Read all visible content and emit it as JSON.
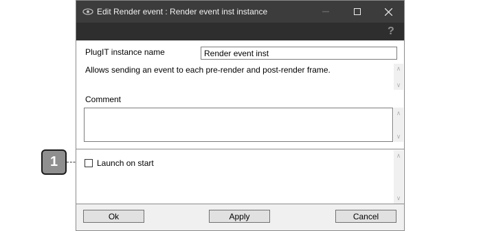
{
  "window": {
    "title": "Edit Render event : Render event inst instance",
    "minimize_glyph": "—",
    "maximize_glyph": "☐",
    "close_glyph": "✕"
  },
  "toolbar": {
    "help_glyph": "?"
  },
  "form": {
    "instance_name_label": "PlugIT instance name",
    "instance_name_value": "Render event inst",
    "description": "Allows sending an event to each pre-render and post-render frame.",
    "comment_label": "Comment",
    "comment_value": "",
    "launch_on_start_label": "Launch on start",
    "launch_on_start_checked": false
  },
  "footer": {
    "ok_label": "Ok",
    "apply_label": "Apply",
    "cancel_label": "Cancel"
  },
  "annotation": {
    "callout_number": "1"
  },
  "icons": {
    "app": "eye-icon",
    "help": "help-icon",
    "scroll_up": "chevron-up-icon",
    "scroll_down": "chevron-down-icon"
  }
}
